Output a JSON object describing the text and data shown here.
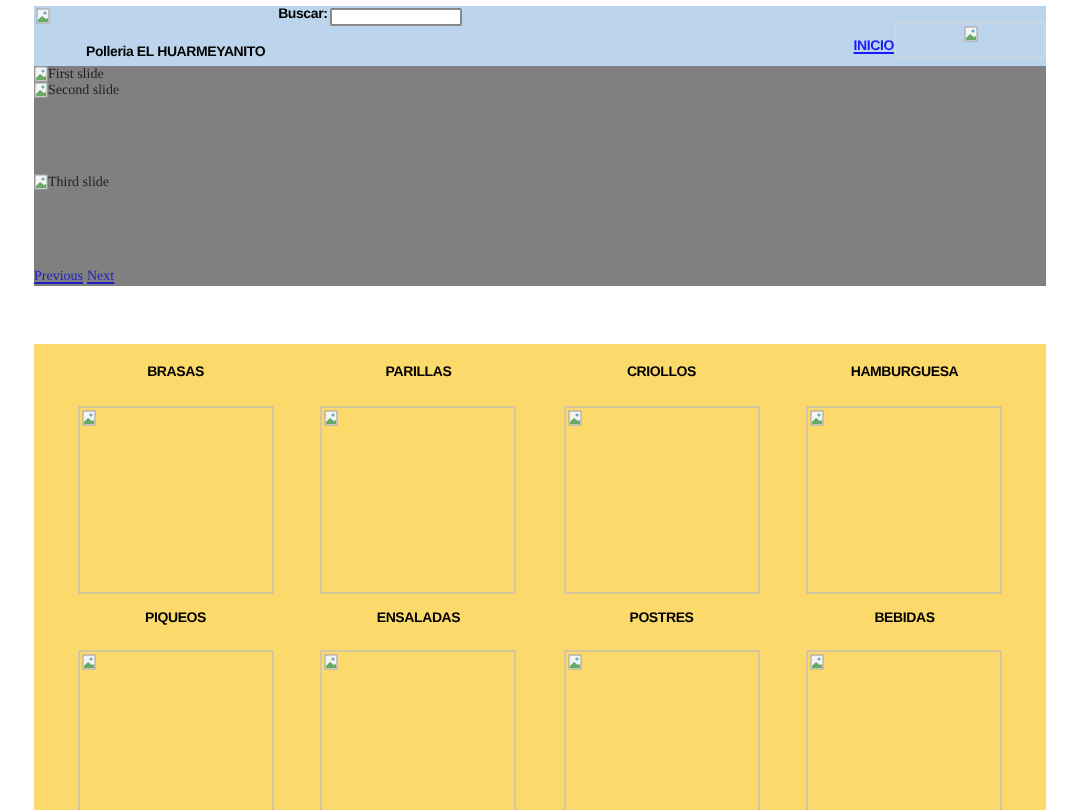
{
  "header": {
    "search_label": "Buscar:",
    "brand": "Polleria EL HUARMEYANITO",
    "nav_link": "INICIO"
  },
  "carousel": {
    "slides": [
      {
        "alt": "First slide"
      },
      {
        "alt": "Second slide"
      },
      {
        "alt": "Third slide"
      }
    ],
    "prev": "Previous",
    "next": "Next"
  },
  "categories": [
    {
      "name": "BRASAS"
    },
    {
      "name": "PARILLAS"
    },
    {
      "name": "CRIOLLOS"
    },
    {
      "name": "HAMBURGUESA"
    },
    {
      "name": "PIQUEOS"
    },
    {
      "name": "ENSALADAS"
    },
    {
      "name": "POSTRES"
    },
    {
      "name": "BEBIDAS"
    }
  ]
}
